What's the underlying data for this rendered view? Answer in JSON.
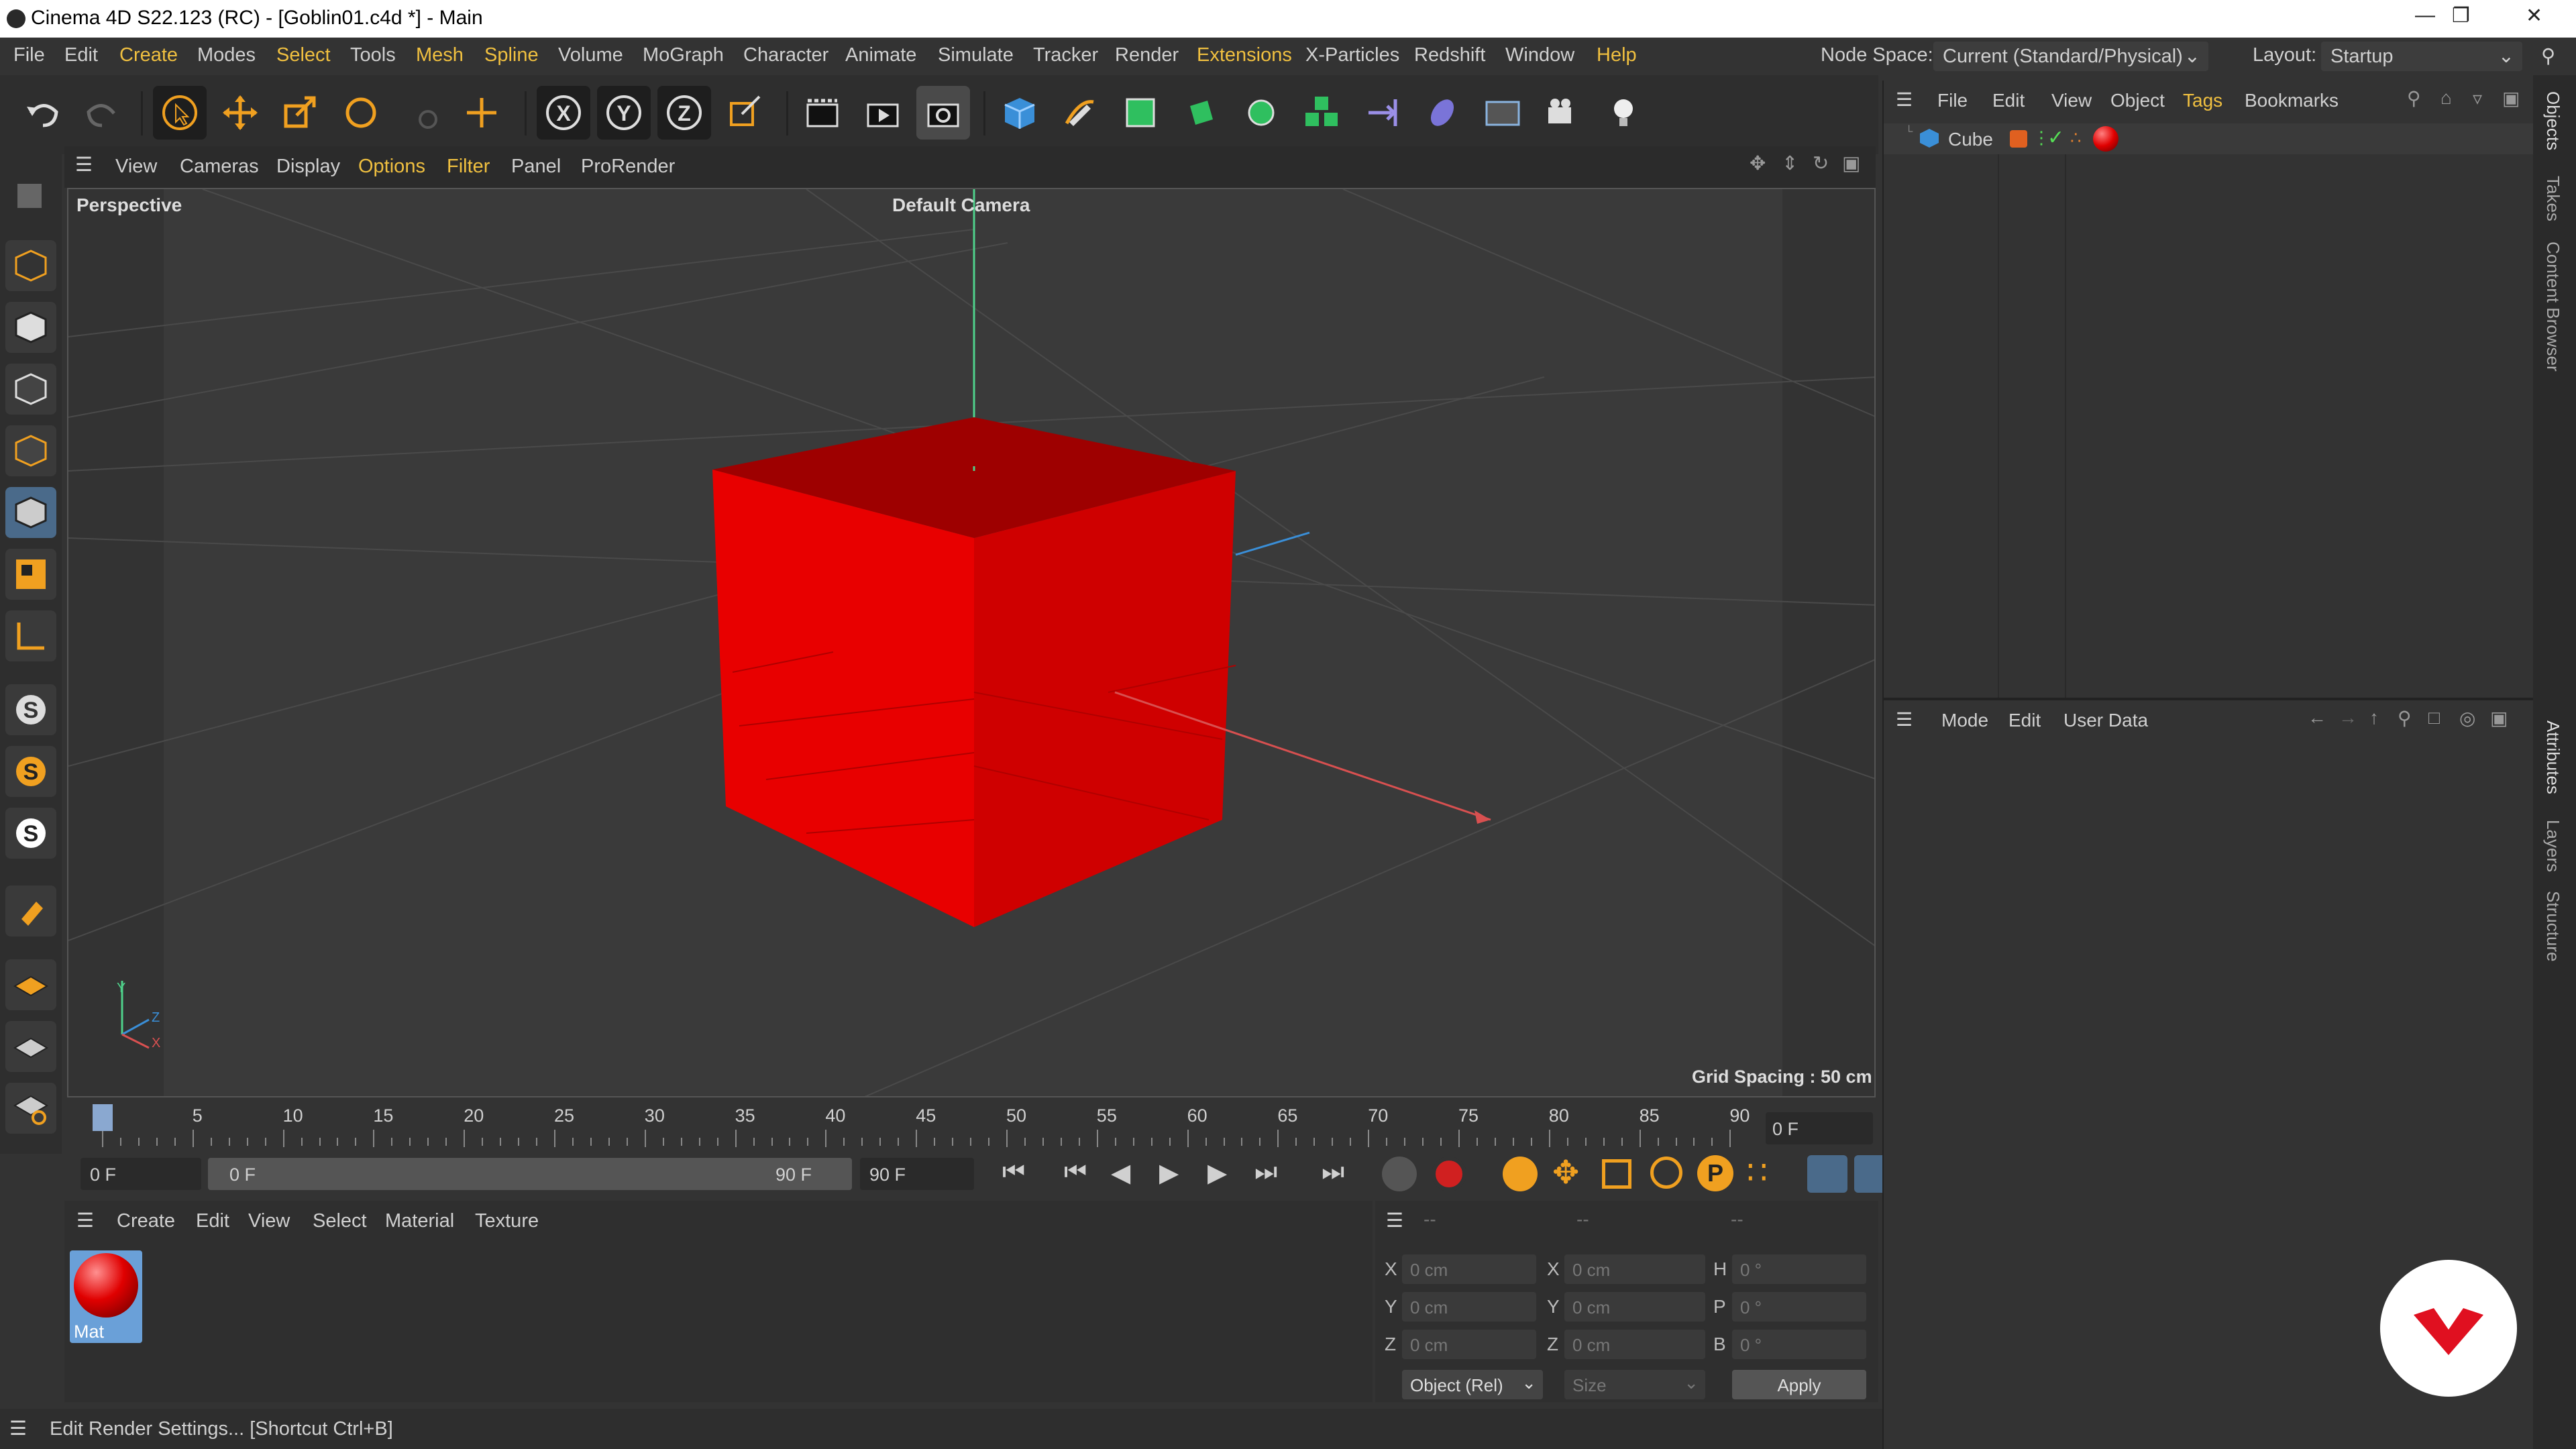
{
  "window": {
    "title": "Cinema 4D S22.123 (RC) - [Goblin01.c4d *] - Main"
  },
  "menubar": {
    "items": [
      "File",
      "Edit",
      "Create",
      "Modes",
      "Select",
      "Tools",
      "Mesh",
      "Spline",
      "Volume",
      "MoGraph",
      "Character",
      "Animate",
      "Simulate",
      "Tracker",
      "Render",
      "Extensions",
      "X-Particles",
      "Redshift",
      "Window",
      "Help"
    ],
    "node_space_label": "Node Space:",
    "node_space_value": "Current (Standard/Physical)",
    "layout_label": "Layout:",
    "layout_value": "Startup"
  },
  "viewport": {
    "menu": [
      "View",
      "Cameras",
      "Display",
      "Options",
      "Filter",
      "Panel",
      "ProRender"
    ],
    "view_name": "Perspective",
    "camera_name": "Default Camera",
    "grid_spacing": "Grid Spacing : 50 cm",
    "axis_labels": {
      "y": "Y",
      "z": "Z",
      "x": "X"
    },
    "object_color": "#e00000"
  },
  "timeline": {
    "ticks": [
      "0",
      "5",
      "10",
      "15",
      "20",
      "25",
      "30",
      "35",
      "40",
      "45",
      "50",
      "55",
      "60",
      "65",
      "70",
      "75",
      "80",
      "85",
      "90"
    ],
    "current_frame": "0 F",
    "start_frame": "0 F",
    "range_start": "0 F",
    "range_end": "90 F",
    "end_frame": "90 F"
  },
  "material_manager": {
    "menu": [
      "Create",
      "Edit",
      "View",
      "Select",
      "Material",
      "Texture"
    ],
    "materials": [
      {
        "name": "Mat"
      }
    ]
  },
  "coordinates": {
    "headers": [
      "--",
      "--",
      "--"
    ],
    "rows": [
      {
        "a": "X",
        "av": "0 cm",
        "b": "X",
        "bv": "0 cm",
        "c": "H",
        "cv": "0 °"
      },
      {
        "a": "Y",
        "av": "0 cm",
        "b": "Y",
        "bv": "0 cm",
        "c": "P",
        "cv": "0 °"
      },
      {
        "a": "Z",
        "av": "0 cm",
        "b": "Z",
        "bv": "0 cm",
        "c": "B",
        "cv": "0 °"
      }
    ],
    "mode_select": "Object (Rel)",
    "size_select": "Size",
    "apply_label": "Apply"
  },
  "status": {
    "text": "Edit Render Settings... [Shortcut Ctrl+B]"
  },
  "object_manager": {
    "menu": [
      "File",
      "Edit",
      "View",
      "Object",
      "Tags",
      "Bookmarks"
    ],
    "objects": [
      {
        "name": "Cube"
      }
    ]
  },
  "attribute_manager": {
    "menu": [
      "Mode",
      "Edit",
      "User Data"
    ]
  },
  "side_tabs": {
    "top": [
      "Objects",
      "Takes",
      "Content Browser"
    ],
    "bottom": [
      "Attributes",
      "Layers",
      "Structure"
    ]
  }
}
